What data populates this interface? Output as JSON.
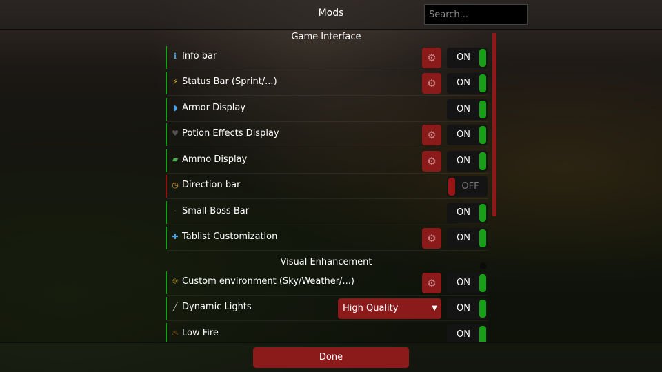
{
  "header": {
    "title": "Mods",
    "search_placeholder": "Search..."
  },
  "sections": [
    {
      "title": "Game Interface",
      "mods": [
        {
          "name": "Info bar",
          "icon": "info-icon",
          "settings": true,
          "state": "ON",
          "enabled": true
        },
        {
          "name": "Status Bar (Sprint/...)",
          "icon": "lightning-icon",
          "settings": true,
          "state": "ON",
          "enabled": true
        },
        {
          "name": "Armor Display",
          "icon": "shield-icon",
          "settings": false,
          "state": "ON",
          "enabled": true
        },
        {
          "name": "Potion Effects Display",
          "icon": "heart-icon",
          "settings": true,
          "state": "ON",
          "enabled": true
        },
        {
          "name": "Ammo Display",
          "icon": "gun-icon",
          "settings": true,
          "state": "ON",
          "enabled": true
        },
        {
          "name": "Direction bar",
          "icon": "clock-icon",
          "settings": false,
          "state": "OFF",
          "enabled": false
        },
        {
          "name": "Small Boss-Bar",
          "icon": "dot-icon",
          "settings": false,
          "state": "ON",
          "enabled": true
        },
        {
          "name": "Tablist Customization",
          "icon": "puzzle-icon",
          "settings": true,
          "state": "ON",
          "enabled": true
        }
      ]
    },
    {
      "title": "Visual Enhancement",
      "mods": [
        {
          "name": "Custom environment (Sky/Weather/...)",
          "icon": "weather-icon",
          "settings": true,
          "state": "ON",
          "enabled": true
        },
        {
          "name": "Dynamic Lights",
          "icon": "torch-icon",
          "settings": false,
          "dropdown": "High Quality",
          "state": "ON",
          "enabled": true
        },
        {
          "name": "Low Fire",
          "icon": "fire-icon",
          "settings": false,
          "state": "ON",
          "enabled": true
        }
      ]
    }
  ],
  "footer": {
    "done_label": "Done"
  },
  "icons": {
    "gear": "⚙",
    "caret": "▼",
    "info-icon": "ℹ",
    "lightning-icon": "⚡",
    "shield-icon": "◗",
    "heart-icon": "♥",
    "gun-icon": "▰",
    "clock-icon": "◷",
    "dot-icon": "·",
    "puzzle-icon": "✚",
    "weather-icon": "☼",
    "torch-icon": "╱",
    "fire-icon": "♨"
  },
  "colors": {
    "accent_red": "#8b1a1a",
    "on_green": "#17a017",
    "off_red": "#9a1414",
    "icon_blue": "#4aa3e6",
    "icon_yellow": "#f0c020",
    "icon_orange": "#f08020"
  }
}
